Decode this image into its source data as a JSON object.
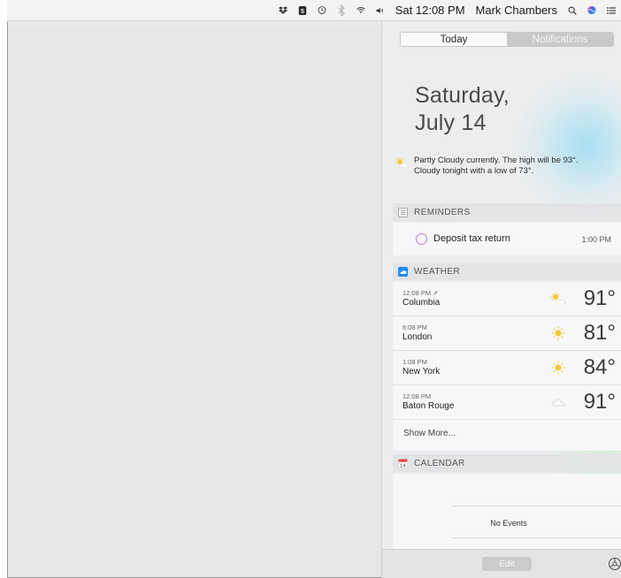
{
  "menubar": {
    "icons": [
      "dropbox-icon",
      "evernote-icon",
      "time-machine-icon",
      "bluetooth-icon",
      "wifi-icon",
      "volume-icon"
    ],
    "clock": "Sat 12:08 PM",
    "user": "Mark Chambers",
    "search_icon": "spotlight-icon",
    "siri_icon": "siri-icon",
    "notification_icon": "notification-center-icon"
  },
  "panel": {
    "tabs": [
      {
        "label": "Today",
        "active": true
      },
      {
        "label": "Notifications",
        "active": false
      }
    ],
    "date": {
      "line1": "Saturday,",
      "line2": "July 14"
    },
    "summary": {
      "icon": "partly-cloudy-icon",
      "text1": "Partly Cloudy currently. The high will be 93°.",
      "text2": "Cloudy tonight with a low of 73°."
    },
    "reminders": {
      "title": "REMINDERS",
      "items": [
        {
          "title": "Deposit tax return",
          "time": "1:00 PM"
        }
      ]
    },
    "weather": {
      "title": "WEATHER",
      "rows": [
        {
          "time": "12:08 PM",
          "location_arrow": true,
          "city": "Columbia",
          "icon": "partly-sunny-icon",
          "temp": "91°"
        },
        {
          "time": "6:08 PM",
          "city": "London",
          "icon": "sun-icon",
          "temp": "81°"
        },
        {
          "time": "1:08 PM",
          "city": "New York",
          "icon": "sun-icon",
          "temp": "84°"
        },
        {
          "time": "12:08 PM",
          "city": "Baton Rouge",
          "icon": "cloud-icon",
          "temp": "91°"
        }
      ],
      "show_more": "Show More..."
    },
    "calendar": {
      "title": "CALENDAR",
      "empty_text": "No Events"
    },
    "footer": {
      "edit_label": "Edit",
      "gear_icon": "gear-icon"
    }
  },
  "colors": {
    "reminder_circle": "#c27bd8",
    "sun": "#f6c83a",
    "weather_icon_bg": "#1f8df0",
    "calendar_icon": "#e8453c"
  }
}
